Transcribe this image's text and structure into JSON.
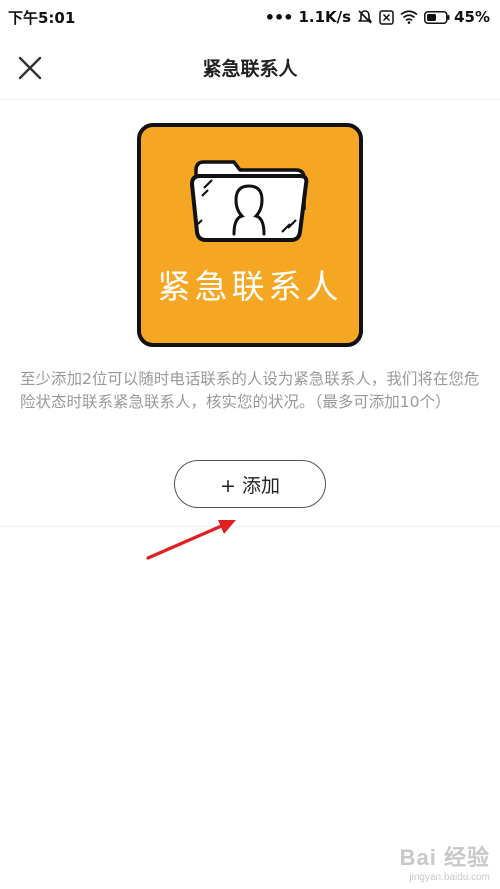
{
  "status_bar": {
    "time": "下午5:01",
    "network_speed": "1.1K/s",
    "battery": "45%"
  },
  "header": {
    "title": "紧急联系人"
  },
  "illustration": {
    "caption": "紧急联系人",
    "background_color": "#F5A623"
  },
  "main": {
    "description": "至少添加2位可以随时电话联系的人设为紧急联系人，我们将在您危险状态时联系紧急联系人，核实您的状况。（最多可添加10个）",
    "add_button_label": "+ 添加"
  },
  "annotation": {
    "arrow_color": "#E02020"
  },
  "watermark": {
    "brand": "Bai 经验",
    "url": "jingyan.baidu.com"
  }
}
